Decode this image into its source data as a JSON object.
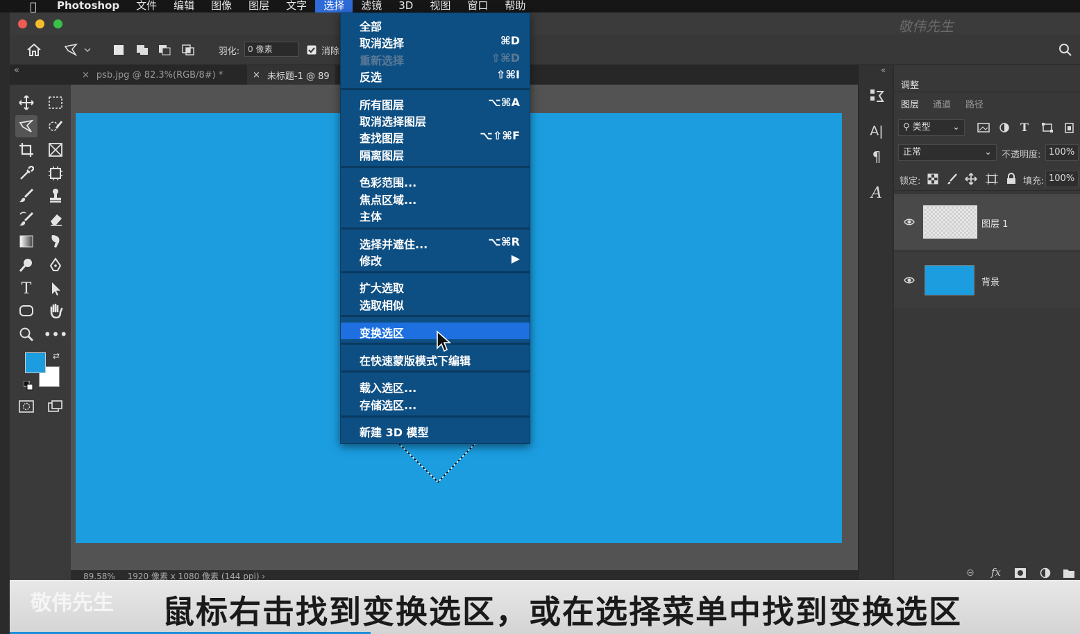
{
  "menubar": {
    "app": "Photoshop",
    "items": [
      "文件",
      "编辑",
      "图像",
      "图层",
      "文字",
      "选择",
      "滤镜",
      "3D",
      "视图",
      "窗口",
      "帮助"
    ],
    "active_index": 5
  },
  "watermark_top": "敬伟先生",
  "options": {
    "feather_label": "羽化:",
    "feather_value": "0 像素",
    "antialias_label": "消除"
  },
  "tabs": [
    {
      "label": "psb.jpg @ 82.3%(RGB/8#) *"
    },
    {
      "label": "未标题-1 @ 89"
    }
  ],
  "select_menu": {
    "groups": [
      [
        {
          "label": "全部",
          "shortcut": ""
        },
        {
          "label": "取消选择",
          "shortcut": "⌘D"
        },
        {
          "label": "重新选择",
          "shortcut": "⇧⌘D",
          "disabled": true
        },
        {
          "label": "反选",
          "shortcut": "⇧⌘I"
        }
      ],
      [
        {
          "label": "所有图层",
          "shortcut": "⌥⌘A"
        },
        {
          "label": "取消选择图层",
          "shortcut": ""
        },
        {
          "label": "查找图层",
          "shortcut": "⌥⇧⌘F"
        },
        {
          "label": "隔离图层",
          "shortcut": ""
        }
      ],
      [
        {
          "label": "色彩范围...",
          "shortcut": ""
        },
        {
          "label": "焦点区域...",
          "shortcut": ""
        },
        {
          "label": "主体",
          "shortcut": ""
        }
      ],
      [
        {
          "label": "选择并遮住...",
          "shortcut": "⌥⌘R"
        },
        {
          "label": "修改",
          "shortcut": "▶"
        }
      ],
      [
        {
          "label": "扩大选取",
          "shortcut": ""
        },
        {
          "label": "选取相似",
          "shortcut": ""
        }
      ],
      [
        {
          "label": "变换选区",
          "shortcut": "",
          "highlighted": true
        }
      ],
      [
        {
          "label": "在快速蒙版模式下编辑",
          "shortcut": ""
        }
      ],
      [
        {
          "label": "载入选区...",
          "shortcut": ""
        },
        {
          "label": "存储选区...",
          "shortcut": ""
        }
      ],
      [
        {
          "label": "新建 3D 模型",
          "shortcut": ""
        }
      ]
    ]
  },
  "status": {
    "zoom": "89.58%",
    "info": "1920 像素 x 1080 像素 (144 ppi)  ›"
  },
  "panel": {
    "adjust_tab": "调整",
    "tabs": [
      "图层",
      "通道",
      "路径"
    ],
    "filter_kind": "类型",
    "blend_mode": "正常",
    "opacity_label": "不透明度:",
    "opacity_value": "100%",
    "lock_label": "锁定:",
    "fill_label": "填充:",
    "fill_value": "100%",
    "layers": [
      {
        "name": "图层 1"
      },
      {
        "name": "背景"
      }
    ]
  },
  "colors": {
    "foreground": "#1b9de0",
    "background": "#ffffff",
    "canvas": "#1b9de0",
    "menu_bg": "#0e4f83",
    "highlight": "#1e70e0"
  },
  "caption": {
    "brand": "敬伟先生",
    "text": "鼠标右击找到变换选区，或在选择菜单中找到变换选区"
  }
}
